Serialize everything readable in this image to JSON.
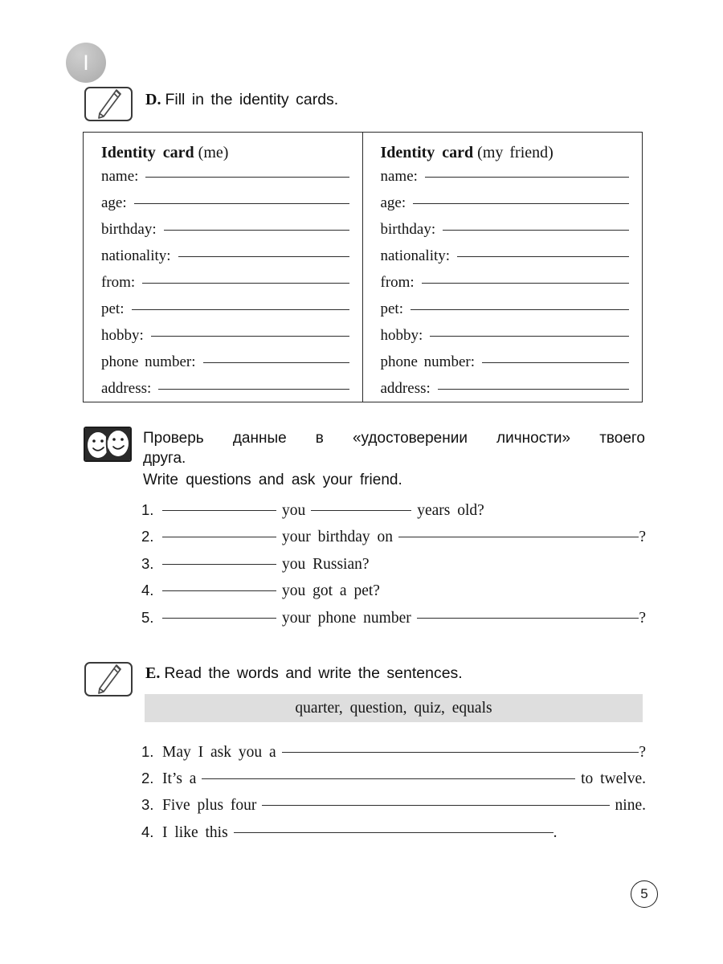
{
  "unit": {
    "numeral": "I"
  },
  "exercise_d": {
    "letter": "D.",
    "instruction": "Fill in the identity cards.",
    "icon": "pencil-on-card-icon",
    "cards": [
      {
        "title_strong": "Identity card",
        "title_paren": "(me)",
        "fields": [
          {
            "label": "name:"
          },
          {
            "label": "age:"
          },
          {
            "label": "birthday:"
          },
          {
            "label": "nationality:"
          },
          {
            "label": "from:"
          },
          {
            "label": "pet:"
          },
          {
            "label": "hobby:"
          },
          {
            "label": "phone number:"
          },
          {
            "label": "address:"
          }
        ]
      },
      {
        "title_strong": "Identity card",
        "title_paren": "(my friend)",
        "fields": [
          {
            "label": "name:"
          },
          {
            "label": "age:"
          },
          {
            "label": "birthday:"
          },
          {
            "label": "nationality:"
          },
          {
            "label": "from:"
          },
          {
            "label": "pet:"
          },
          {
            "label": "hobby:"
          },
          {
            "label": "phone number:"
          },
          {
            "label": "address:"
          }
        ]
      }
    ]
  },
  "instruction_block": {
    "icon": "two-faces-icon",
    "ru_line_1": "Проверь данные в «удостоверении личности» твоего",
    "ru_line_2": "друга.",
    "en_line": "Write questions and ask your friend."
  },
  "questions": [
    {
      "num": "1.",
      "before_blank": "",
      "mid": "you",
      "after": "years old?",
      "two_blanks": true,
      "end_mark": ""
    },
    {
      "num": "2.",
      "mid": "your birthday on",
      "after": "",
      "two_blanks": true,
      "end_mark": "?"
    },
    {
      "num": "3.",
      "mid": "you Russian?",
      "two_blanks": false,
      "end_mark": ""
    },
    {
      "num": "4.",
      "mid": "you got a pet?",
      "two_blanks": false,
      "end_mark": ""
    },
    {
      "num": "5.",
      "mid": "your phone number",
      "two_blanks": true,
      "end_mark": "?"
    }
  ],
  "exercise_e": {
    "letter": "E.",
    "instruction": "Read the words and write the sentences.",
    "icon": "pencil-on-card-icon",
    "word_bank": "quarter,  question,  quiz,  equals"
  },
  "sentences": [
    {
      "num": "1.",
      "lead": "May I ask you a",
      "tail": "",
      "end_mark": "?"
    },
    {
      "num": "2.",
      "lead": "It’s a",
      "tail": "to twelve.",
      "end_mark": ""
    },
    {
      "num": "3.",
      "lead": "Five plus four",
      "tail": "nine.",
      "end_mark": ""
    },
    {
      "num": "4.",
      "lead": "I like this",
      "tail": "",
      "end_mark": "."
    }
  ],
  "page": {
    "number": "5"
  },
  "colors": {
    "badge_gray": "#bbbbbb",
    "word_bank_gray": "#dedede",
    "ink": "#141414"
  }
}
